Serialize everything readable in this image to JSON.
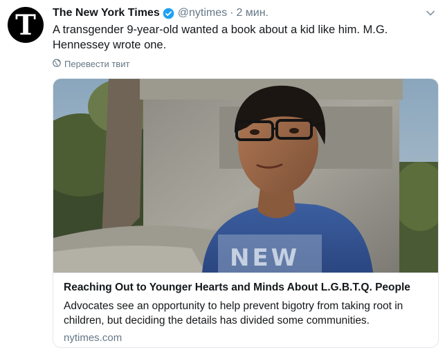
{
  "tweet": {
    "author_name": "The New York Times",
    "author_avatar_letter": "T",
    "handle": "@nytimes",
    "separator": "·",
    "time": "2 мин.",
    "text": "A transgender 9-year-old wanted a book about a kid like him. M.G. Hennessey wrote one.",
    "translate_label": "Перевести твит",
    "icons": [
      "verified-badge-icon",
      "chevron-down-icon",
      "globe-icon"
    ],
    "colors": {
      "verified": "#1da1f2",
      "secondary_text": "#657786",
      "border": "#e1e8ed"
    }
  },
  "card": {
    "image_overlay_text": "NEW",
    "title": "Reaching Out to Younger Hearts and Minds About L.G.B.T.Q. People",
    "description": "Advocates see an opportunity to help prevent bigotry from taking root in children, but deciding the details has divided some communities.",
    "domain": "nytimes.com"
  }
}
